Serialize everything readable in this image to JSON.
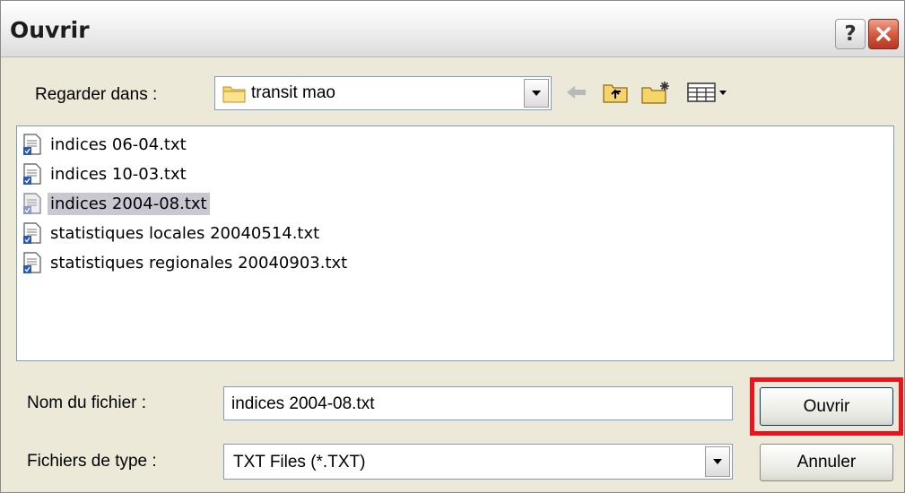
{
  "dialog": {
    "title": "Ouvrir",
    "help_symbol": "?"
  },
  "look_in": {
    "label": "Regarder dans :",
    "value": "transit mao",
    "icon": "folder-icon"
  },
  "toolbar": {
    "icons": [
      "back-arrow-icon",
      "up-folder-icon",
      "new-folder-icon",
      "view-menu-icon"
    ]
  },
  "files": [
    {
      "name": "indices 06-04.txt",
      "selected": false
    },
    {
      "name": "indices 10-03.txt",
      "selected": false
    },
    {
      "name": "indices 2004-08.txt",
      "selected": true
    },
    {
      "name": "statistiques locales 20040514.txt",
      "selected": false
    },
    {
      "name": "statistiques regionales 20040903.txt",
      "selected": false
    }
  ],
  "filename": {
    "label": "Nom du fichier :",
    "value": "indices 2004-08.txt"
  },
  "filetype": {
    "label": "Fichiers de type :",
    "value": "TXT Files (*.TXT)"
  },
  "buttons": {
    "open": "Ouvrir",
    "cancel": "Annuler"
  },
  "colors": {
    "highlight": "#e8141e",
    "selection": "#c8c8d2",
    "dialog_bg": "#ece9d8"
  }
}
